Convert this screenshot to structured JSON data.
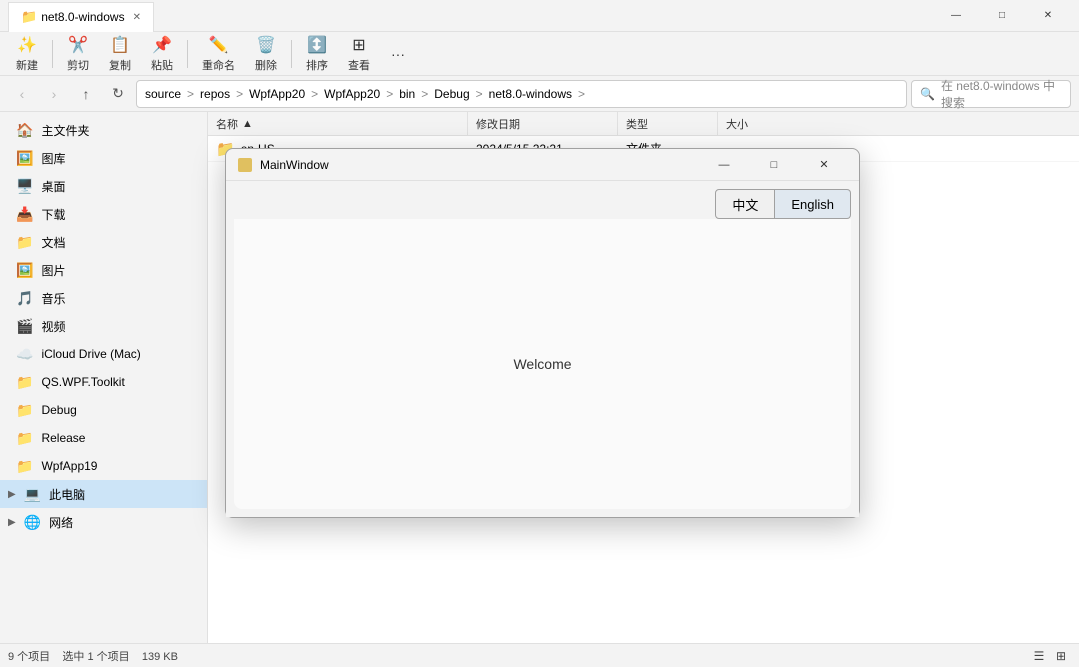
{
  "titleBar": {
    "title": "net8.0-windows",
    "icon": "folder"
  },
  "windowControls": {
    "minimize": "—",
    "maximize": "□",
    "close": "✕"
  },
  "toolbar": {
    "newLabel": "新建",
    "cutLabel": "剪切",
    "copyLabel": "复制",
    "pasteLabel": "粘贴",
    "renameLabel": "重命名",
    "deleteLabel": "删除",
    "sortLabel": "排序",
    "viewLabel": "查看",
    "moreLabel": "···"
  },
  "addressBar": {
    "segments": [
      "source",
      "repos",
      "WpfApp20",
      "WpfApp20",
      "bin",
      "Debug",
      "net8.0-windows"
    ],
    "searchPlaceholder": "在 net8.0-windows 中搜索"
  },
  "sidebar": {
    "items": [
      {
        "label": "主文件夹",
        "icon": "🏠",
        "pinned": true,
        "type": "pinned"
      },
      {
        "label": "图库",
        "icon": "🖼️",
        "pinned": true,
        "type": "pinned"
      },
      {
        "label": "桌面",
        "icon": "🖥️",
        "pinned": true,
        "type": "quick"
      },
      {
        "label": "下载",
        "icon": "📥",
        "pinned": true,
        "type": "quick"
      },
      {
        "label": "文档",
        "icon": "📁",
        "pinned": true,
        "type": "quick"
      },
      {
        "label": "图片",
        "icon": "🖼️",
        "pinned": true,
        "type": "quick"
      },
      {
        "label": "音乐",
        "icon": "🎵",
        "pinned": true,
        "type": "quick"
      },
      {
        "label": "视频",
        "icon": "🎬",
        "pinned": true,
        "type": "quick"
      },
      {
        "label": "iCloud Drive (Mac)",
        "icon": "☁️",
        "pinned": true,
        "type": "quick"
      },
      {
        "label": "QS.WPF.Toolkit",
        "icon": "📁",
        "pinned": false,
        "type": "folder"
      },
      {
        "label": "Debug",
        "icon": "📁",
        "pinned": false,
        "type": "folder"
      },
      {
        "label": "Release",
        "icon": "📁",
        "pinned": false,
        "type": "folder"
      },
      {
        "label": "WpfApp19",
        "icon": "📁",
        "pinned": false,
        "type": "folder"
      },
      {
        "label": "此电脑",
        "icon": "💻",
        "pinned": false,
        "type": "tree",
        "expanded": true
      },
      {
        "label": "网络",
        "icon": "🌐",
        "pinned": false,
        "type": "tree"
      }
    ]
  },
  "fileList": {
    "columns": [
      "名称",
      "修改日期",
      "类型",
      "大小"
    ],
    "rows": [
      {
        "name": "en-US",
        "icon": "folder",
        "date": "2024/5/15 22:21",
        "type": "文件夹",
        "size": ""
      }
    ]
  },
  "statusBar": {
    "itemCount": "9 个项目",
    "selectedInfo": "选中 1 个项目",
    "selectedSize": "139 KB"
  },
  "dialog": {
    "title": "MainWindow",
    "icon": "window",
    "langButtons": [
      "中文",
      "English"
    ],
    "welcomeText": "Welcome"
  }
}
